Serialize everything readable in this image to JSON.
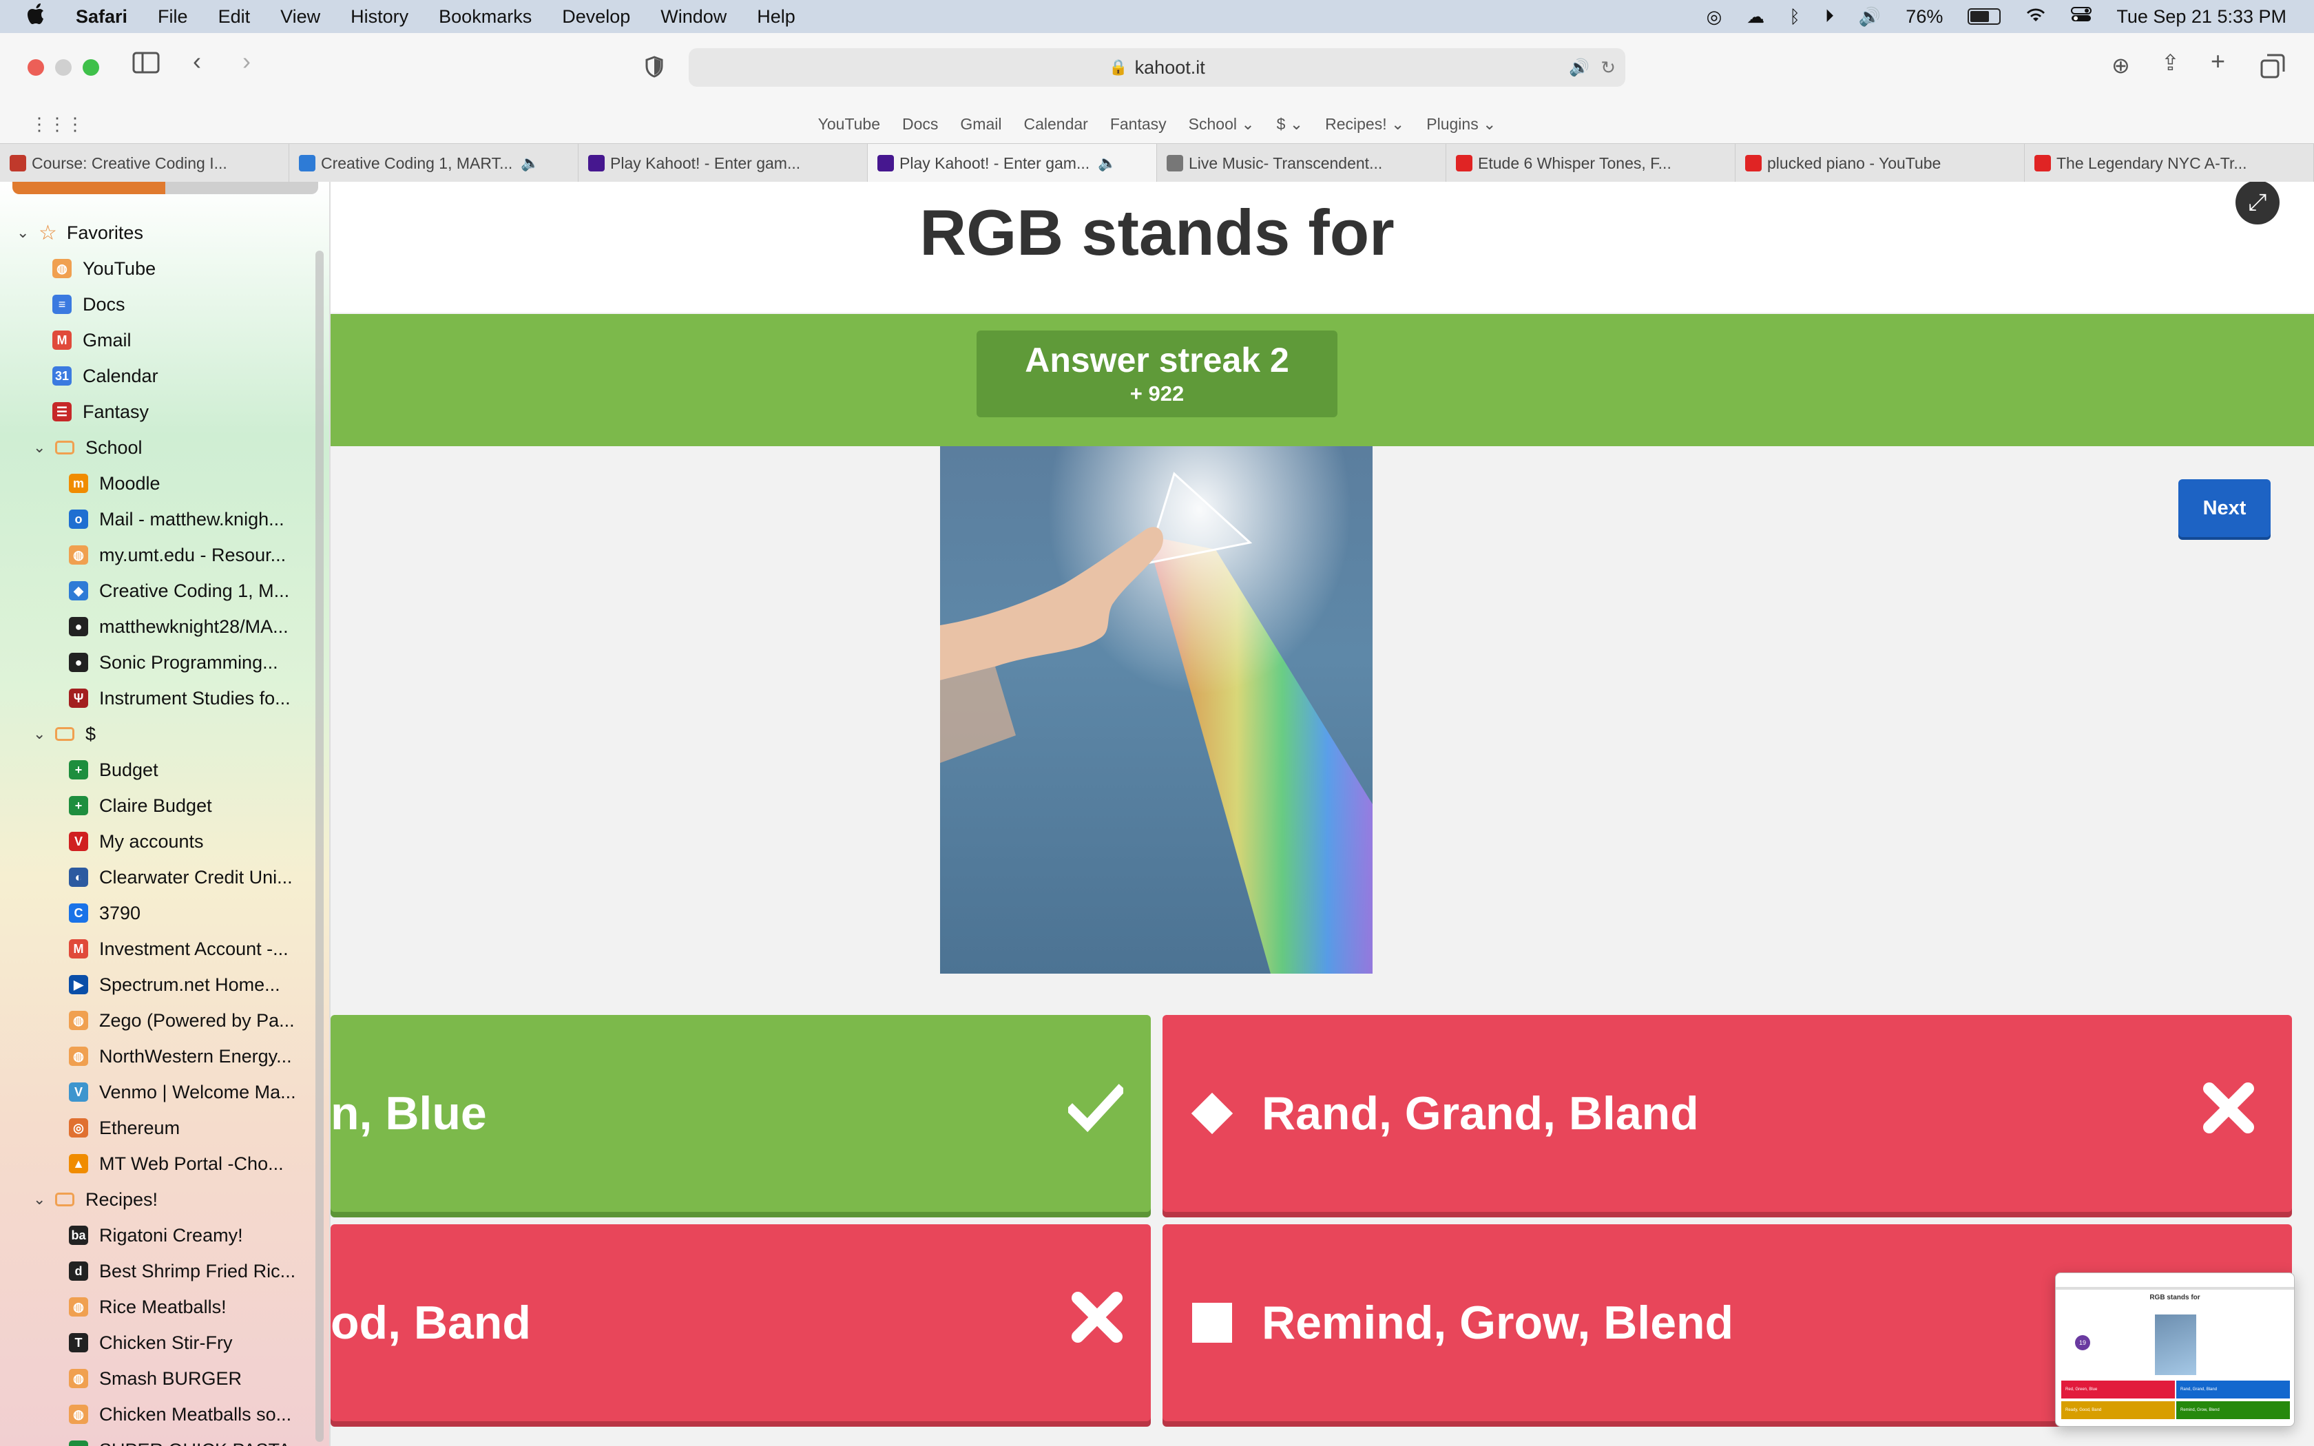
{
  "menubar": {
    "apple": "",
    "items": [
      "Safari",
      "File",
      "Edit",
      "View",
      "History",
      "Bookmarks",
      "Develop",
      "Window",
      "Help"
    ],
    "battery_percent": "76%",
    "battery_level": 0.76,
    "datetime": "Tue Sep 21  5:33 PM"
  },
  "toolbar": {
    "url": "kahoot.it"
  },
  "favorites_bar": {
    "items": [
      "YouTube",
      "Docs",
      "Gmail",
      "Calendar",
      "Fantasy",
      "School ⌄",
      "$ ⌄",
      "Recipes! ⌄",
      "Plugins ⌄"
    ]
  },
  "tabs": [
    {
      "title": "Course: Creative Coding I...",
      "icon_color": "#c0392b",
      "speaker": false
    },
    {
      "title": "Creative Coding 1, MART...",
      "icon_color": "#2e7bd6",
      "speaker": true
    },
    {
      "title": "Play Kahoot! - Enter gam...",
      "icon_color": "#46178f",
      "speaker": false
    },
    {
      "title": "Play Kahoot! - Enter gam...",
      "icon_color": "#46178f",
      "speaker": true
    },
    {
      "title": "Live Music- Transcendent...",
      "icon_color": "#777777",
      "speaker": false
    },
    {
      "title": "Etude 6 Whisper Tones, F...",
      "icon_color": "#e02424",
      "speaker": false
    },
    {
      "title": "plucked piano - YouTube",
      "icon_color": "#e02424",
      "speaker": false
    },
    {
      "title": "The Legendary NYC A-Tr...",
      "icon_color": "#e02424",
      "speaker": false
    }
  ],
  "sidebar": {
    "favorites_label": "Favorites",
    "items": [
      {
        "label": "YouTube",
        "color": "#f0a050",
        "glyph": "◍",
        "indent": 1
      },
      {
        "label": "Docs",
        "color": "#3b7ae0",
        "glyph": "≡",
        "indent": 1
      },
      {
        "label": "Gmail",
        "color": "#e04a3a",
        "glyph": "M",
        "indent": 1
      },
      {
        "label": "Calendar",
        "color": "#3b7ae0",
        "glyph": "31",
        "indent": 1
      },
      {
        "label": "Fantasy",
        "color": "#c62828",
        "glyph": "☰",
        "indent": 1
      },
      {
        "label": "School",
        "color": "#f0a050",
        "glyph": "▭",
        "indent": 1,
        "folder": true
      },
      {
        "label": "Moodle",
        "color": "#f08c00",
        "glyph": "m",
        "indent": 2
      },
      {
        "label": "Mail - matthew.knigh...",
        "color": "#1f6fd1",
        "glyph": "o",
        "indent": 2
      },
      {
        "label": "my.umt.edu - Resour...",
        "color": "#f0a050",
        "glyph": "◍",
        "indent": 2
      },
      {
        "label": "Creative Coding 1, M...",
        "color": "#2e7bd6",
        "glyph": "◆",
        "indent": 2
      },
      {
        "label": "matthewknight28/MA...",
        "color": "#222222",
        "glyph": "●",
        "indent": 2
      },
      {
        "label": "Sonic Programming...",
        "color": "#222222",
        "glyph": "●",
        "indent": 2
      },
      {
        "label": "Instrument Studies fo...",
        "color": "#a31f1f",
        "glyph": "Ψ",
        "indent": 2
      },
      {
        "label": "$",
        "color": "#f0a050",
        "glyph": "▭",
        "indent": 1,
        "folder": true
      },
      {
        "label": "Budget",
        "color": "#1e8e3e",
        "glyph": "+",
        "indent": 2
      },
      {
        "label": "Claire Budget",
        "color": "#1e8e3e",
        "glyph": "+",
        "indent": 2
      },
      {
        "label": "My accounts",
        "color": "#d02020",
        "glyph": "V",
        "indent": 2
      },
      {
        "label": "Clearwater Credit Uni...",
        "color": "#2c5aa0",
        "glyph": "◐",
        "indent": 2
      },
      {
        "label": "3790",
        "color": "#1a73e8",
        "glyph": "C",
        "indent": 2
      },
      {
        "label": "Investment Account -...",
        "color": "#e04a3a",
        "glyph": "M",
        "indent": 2
      },
      {
        "label": "Spectrum.net Home...",
        "color": "#0a4ea8",
        "glyph": "▶",
        "indent": 2
      },
      {
        "label": "Zego (Powered by Pa...",
        "color": "#f0a050",
        "glyph": "◍",
        "indent": 2
      },
      {
        "label": "NorthWestern Energy...",
        "color": "#f0a050",
        "glyph": "◍",
        "indent": 2
      },
      {
        "label": "Venmo | Welcome Ma...",
        "color": "#3d95ce",
        "glyph": "V",
        "indent": 2
      },
      {
        "label": "Ethereum",
        "color": "#e07030",
        "glyph": "◎",
        "indent": 2
      },
      {
        "label": "MT Web Portal -Cho...",
        "color": "#f08c00",
        "glyph": "▲",
        "indent": 2
      },
      {
        "label": "Recipes!",
        "color": "#f0a050",
        "glyph": "▭",
        "indent": 1,
        "folder": true
      },
      {
        "label": "Rigatoni Creamy!",
        "color": "#222222",
        "glyph": "ba",
        "indent": 2
      },
      {
        "label": "Best Shrimp Fried Ric...",
        "color": "#222222",
        "glyph": "d",
        "indent": 2
      },
      {
        "label": "Rice Meatballs!",
        "color": "#f0a050",
        "glyph": "◍",
        "indent": 2
      },
      {
        "label": "Chicken Stir-Fry",
        "color": "#222222",
        "glyph": "T",
        "indent": 2
      },
      {
        "label": "Smash BURGER",
        "color": "#f0a050",
        "glyph": "◍",
        "indent": 2
      },
      {
        "label": "Chicken Meatballs so...",
        "color": "#f0a050",
        "glyph": "◍",
        "indent": 2
      },
      {
        "label": "SUPER QUICK PASTA...",
        "color": "#1e8e3e",
        "glyph": "▭",
        "indent": 2
      }
    ]
  },
  "kahoot": {
    "question": "RGB stands for",
    "streak_label": "Answer streak 2",
    "points": "+ 922",
    "next_label": "Next",
    "answers": [
      {
        "text": "n, Blue",
        "result": "correct",
        "color": "#7cb94b"
      },
      {
        "text": "Rand, Grand, Bland",
        "result": "wrong",
        "color": "#e8465a",
        "shape": "diamond"
      },
      {
        "text": "od, Band",
        "result": "wrong",
        "color": "#e8465a"
      },
      {
        "text": "Remind, Grow, Blend",
        "result": "wrong",
        "color": "#e8465a",
        "shape": "square"
      }
    ]
  },
  "thumbnail": {
    "title": "RGB stands for",
    "badge": "19",
    "answers": [
      "Red, Green, Blue",
      "Rand, Grand, Bland",
      "Ready, Good, Band",
      "Remind, Grow, Blend"
    ],
    "colors": [
      "#e21b3c",
      "#1368ce",
      "#d89e00",
      "#26890c"
    ]
  }
}
